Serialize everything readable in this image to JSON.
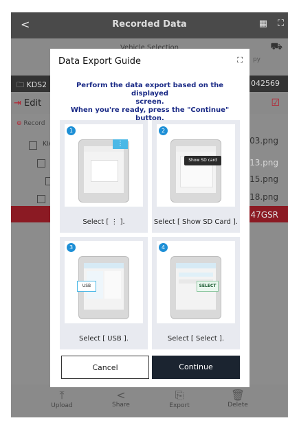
{
  "app": {
    "title": "Recorded Data",
    "back_glyph": "<",
    "subtitle": "Vehicle Selection",
    "copy_label": "py",
    "vehicle_left": "KDS2",
    "vehicle_right": "042569",
    "edit_label": "Edit",
    "record_label": "Record",
    "kia_label": "KIA",
    "files": [
      "803.png",
      "813.png",
      "815.png",
      "818.png",
      "47GSR"
    ]
  },
  "bottom_nav": [
    {
      "label": "Upload",
      "icon": "upload-icon",
      "glyph": "⤒"
    },
    {
      "label": "Share",
      "icon": "share-icon",
      "glyph": "<"
    },
    {
      "label": "Export",
      "icon": "export-icon",
      "glyph": "⎘"
    },
    {
      "label": "Delete",
      "icon": "trash-icon",
      "glyph": "🗑"
    }
  ],
  "dialog": {
    "title": "Data Export Guide",
    "instruction_line1": "Perform the data export based on the displayed",
    "instruction_line2": "screen.",
    "instruction_line3": "When you're ready, press the \"Continue\" button.",
    "steps": [
      {
        "number": "1",
        "caption": "Select [ ⋮ ]."
      },
      {
        "number": "2",
        "caption": "Select [ Show SD Card ].",
        "popup": "Show SD card"
      },
      {
        "number": "3",
        "caption": "Select [ USB ].",
        "popup": "USB"
      },
      {
        "number": "4",
        "caption": "Select [ Select ].",
        "popup": "SELECT"
      }
    ],
    "cancel_label": "Cancel",
    "continue_label": "Continue"
  },
  "colors": {
    "accent": "#1d8fd6",
    "primary_button": "#1b2430",
    "instruction_text": "#1a2a86",
    "highlight_row": "#8b1a23"
  }
}
